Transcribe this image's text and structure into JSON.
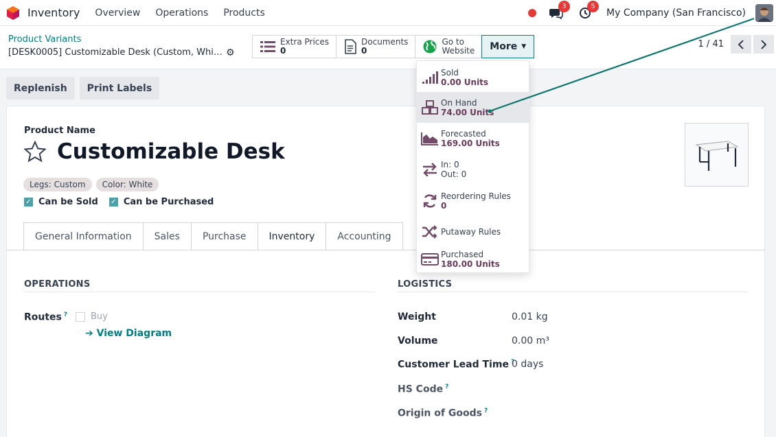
{
  "navbar": {
    "app_name": "Inventory",
    "menu": [
      "Overview",
      "Operations",
      "Products"
    ],
    "chat_badge": "3",
    "activity_badge": "5",
    "company": "My Company (San Francisco)"
  },
  "control": {
    "breadcrumb": "Product Variants",
    "record_name": "[DESK0005] Customizable Desk (Custom, White)",
    "smart_buttons": {
      "extra_prices": {
        "label": "Extra Prices",
        "value": "0"
      },
      "documents": {
        "label": "Documents",
        "value": "0"
      },
      "website": {
        "line1": "Go to",
        "line2": "Website"
      }
    },
    "more_label": "More",
    "pager": "1 / 41"
  },
  "actions": {
    "replenish": "Replenish",
    "print_labels": "Print Labels"
  },
  "product": {
    "name_label": "Product Name",
    "name": "Customizable Desk",
    "tags": [
      "Legs: Custom",
      "Color: White"
    ],
    "can_be_sold": "Can be Sold",
    "can_be_purchased": "Can be Purchased"
  },
  "tabs": [
    "General Information",
    "Sales",
    "Purchase",
    "Inventory",
    "Accounting"
  ],
  "operations": {
    "heading": "OPERATIONS",
    "routes_label": "Routes",
    "buy_label": "Buy",
    "view_diagram": "View Diagram"
  },
  "logistics": {
    "heading": "LOGISTICS",
    "weight_label": "Weight",
    "weight_value": "0.01 kg",
    "volume_label": "Volume",
    "volume_value": "0.00 m³",
    "lead_time_label": "Customer Lead Time",
    "lead_time_value": "0 days",
    "hs_code_label": "HS Code",
    "origin_label": "Origin of Goods",
    "help_mark": "?"
  },
  "more_menu": {
    "sold": {
      "label": "Sold",
      "value": "0.00 Units"
    },
    "on_hand": {
      "label": "On Hand",
      "value": "74.00 Units"
    },
    "forecasted": {
      "label": "Forecasted",
      "value": "169.00 Units"
    },
    "in_out": {
      "in": "In: 0",
      "out": "Out: 0"
    },
    "reordering": {
      "label": "Reordering Rules",
      "value": "0"
    },
    "putaway": {
      "label": "Putaway Rules"
    },
    "purchased": {
      "label": "Purchased",
      "value": "180.00 Units"
    }
  },
  "colors": {
    "accent": "#017e84",
    "badge": "#e53935",
    "menu_value": "#6b3a5b",
    "icon": "#714b67"
  }
}
